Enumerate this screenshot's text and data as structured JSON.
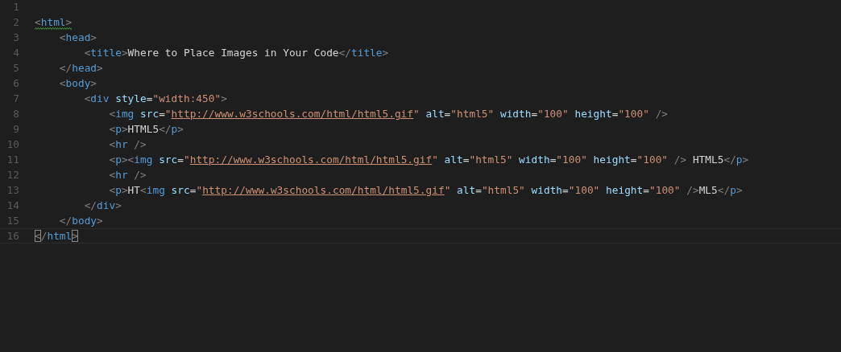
{
  "editor": {
    "lines": [
      {
        "number": "1",
        "current": false
      },
      {
        "number": "2",
        "current": false,
        "warning": true,
        "bracket_match": false,
        "tokens": [
          {
            "kind": "punct",
            "text": "<"
          },
          {
            "kind": "tag",
            "text": "html"
          },
          {
            "kind": "punct",
            "text": ">"
          }
        ]
      },
      {
        "number": "3",
        "current": false,
        "warning": false,
        "bracket_match": false,
        "tokens": [
          {
            "kind": "punct",
            "text": "    <"
          },
          {
            "kind": "tag",
            "text": "head"
          },
          {
            "kind": "punct",
            "text": ">"
          }
        ]
      },
      {
        "number": "4",
        "current": false,
        "warning": false,
        "bracket_match": false,
        "tokens": [
          {
            "kind": "punct",
            "text": "        <"
          },
          {
            "kind": "tag",
            "text": "title"
          },
          {
            "kind": "punct",
            "text": ">"
          },
          {
            "kind": "text",
            "text": "Where to Place Images in Your Code"
          },
          {
            "kind": "punct",
            "text": "</"
          },
          {
            "kind": "tag",
            "text": "title"
          },
          {
            "kind": "punct",
            "text": ">"
          }
        ]
      },
      {
        "number": "5",
        "current": false,
        "warning": false,
        "bracket_match": false,
        "tokens": [
          {
            "kind": "punct",
            "text": "    </"
          },
          {
            "kind": "tag",
            "text": "head"
          },
          {
            "kind": "punct",
            "text": ">"
          }
        ]
      },
      {
        "number": "6",
        "current": false,
        "warning": false,
        "bracket_match": false,
        "tokens": [
          {
            "kind": "punct",
            "text": "    <"
          },
          {
            "kind": "tag",
            "text": "body"
          },
          {
            "kind": "punct",
            "text": ">"
          }
        ]
      },
      {
        "number": "7",
        "current": false,
        "warning": false,
        "bracket_match": false,
        "tokens": [
          {
            "kind": "punct",
            "text": "        <"
          },
          {
            "kind": "tag",
            "text": "div"
          },
          {
            "kind": "attr",
            "text": " style"
          },
          {
            "kind": "eq",
            "text": "="
          },
          {
            "kind": "string",
            "text": "\"width:450\""
          },
          {
            "kind": "punct",
            "text": ">"
          }
        ]
      },
      {
        "number": "8",
        "current": false,
        "warning": false,
        "bracket_match": false,
        "tokens": [
          {
            "kind": "punct",
            "text": "            <"
          },
          {
            "kind": "tag",
            "text": "img"
          },
          {
            "kind": "attr",
            "text": " src"
          },
          {
            "kind": "eq",
            "text": "="
          },
          {
            "kind": "string",
            "text": "\""
          },
          {
            "kind": "url",
            "text": "http://www.w3schools.com/html/html5.gif"
          },
          {
            "kind": "string",
            "text": "\""
          },
          {
            "kind": "attr",
            "text": " alt"
          },
          {
            "kind": "eq",
            "text": "="
          },
          {
            "kind": "string",
            "text": "\"html5\""
          },
          {
            "kind": "attr",
            "text": " width"
          },
          {
            "kind": "eq",
            "text": "="
          },
          {
            "kind": "string",
            "text": "\"100\""
          },
          {
            "kind": "attr",
            "text": " height"
          },
          {
            "kind": "eq",
            "text": "="
          },
          {
            "kind": "string",
            "text": "\"100\""
          },
          {
            "kind": "punct",
            "text": " />"
          }
        ]
      },
      {
        "number": "9",
        "current": false,
        "warning": false,
        "bracket_match": false,
        "tokens": [
          {
            "kind": "punct",
            "text": "            <"
          },
          {
            "kind": "tag",
            "text": "p"
          },
          {
            "kind": "punct",
            "text": ">"
          },
          {
            "kind": "text",
            "text": "HTML5"
          },
          {
            "kind": "punct",
            "text": "</"
          },
          {
            "kind": "tag",
            "text": "p"
          },
          {
            "kind": "punct",
            "text": ">"
          }
        ]
      },
      {
        "number": "10",
        "current": false,
        "warning": false,
        "bracket_match": false,
        "tokens": [
          {
            "kind": "punct",
            "text": "            <"
          },
          {
            "kind": "tag",
            "text": "hr"
          },
          {
            "kind": "punct",
            "text": " />"
          }
        ]
      },
      {
        "number": "11",
        "current": false,
        "warning": false,
        "bracket_match": false,
        "tokens": [
          {
            "kind": "punct",
            "text": "            <"
          },
          {
            "kind": "tag",
            "text": "p"
          },
          {
            "kind": "punct",
            "text": "><"
          },
          {
            "kind": "tag",
            "text": "img"
          },
          {
            "kind": "attr",
            "text": " src"
          },
          {
            "kind": "eq",
            "text": "="
          },
          {
            "kind": "string",
            "text": "\""
          },
          {
            "kind": "url",
            "text": "http://www.w3schools.com/html/html5.gif"
          },
          {
            "kind": "string",
            "text": "\""
          },
          {
            "kind": "attr",
            "text": " alt"
          },
          {
            "kind": "eq",
            "text": "="
          },
          {
            "kind": "string",
            "text": "\"html5\""
          },
          {
            "kind": "attr",
            "text": " width"
          },
          {
            "kind": "eq",
            "text": "="
          },
          {
            "kind": "string",
            "text": "\"100\""
          },
          {
            "kind": "attr",
            "text": " height"
          },
          {
            "kind": "eq",
            "text": "="
          },
          {
            "kind": "string",
            "text": "\"100\""
          },
          {
            "kind": "punct",
            "text": " />"
          },
          {
            "kind": "text",
            "text": " HTML5"
          },
          {
            "kind": "punct",
            "text": "</"
          },
          {
            "kind": "tag",
            "text": "p"
          },
          {
            "kind": "punct",
            "text": ">"
          }
        ]
      },
      {
        "number": "12",
        "current": false,
        "warning": false,
        "bracket_match": false,
        "tokens": [
          {
            "kind": "punct",
            "text": "            <"
          },
          {
            "kind": "tag",
            "text": "hr"
          },
          {
            "kind": "punct",
            "text": " />"
          }
        ]
      },
      {
        "number": "13",
        "current": false,
        "warning": false,
        "bracket_match": false,
        "tokens": [
          {
            "kind": "punct",
            "text": "            <"
          },
          {
            "kind": "tag",
            "text": "p"
          },
          {
            "kind": "punct",
            "text": ">"
          },
          {
            "kind": "text",
            "text": "HT"
          },
          {
            "kind": "punct",
            "text": "<"
          },
          {
            "kind": "tag",
            "text": "img"
          },
          {
            "kind": "attr",
            "text": " src"
          },
          {
            "kind": "eq",
            "text": "="
          },
          {
            "kind": "string",
            "text": "\""
          },
          {
            "kind": "url",
            "text": "http://www.w3schools.com/html/html5.gif"
          },
          {
            "kind": "string",
            "text": "\""
          },
          {
            "kind": "attr",
            "text": " alt"
          },
          {
            "kind": "eq",
            "text": "="
          },
          {
            "kind": "string",
            "text": "\"html5\""
          },
          {
            "kind": "attr",
            "text": " width"
          },
          {
            "kind": "eq",
            "text": "="
          },
          {
            "kind": "string",
            "text": "\"100\""
          },
          {
            "kind": "attr",
            "text": " height"
          },
          {
            "kind": "eq",
            "text": "="
          },
          {
            "kind": "string",
            "text": "\"100\""
          },
          {
            "kind": "punct",
            "text": " />"
          },
          {
            "kind": "text",
            "text": "ML5"
          },
          {
            "kind": "punct",
            "text": "</"
          },
          {
            "kind": "tag",
            "text": "p"
          },
          {
            "kind": "punct",
            "text": ">"
          }
        ]
      },
      {
        "number": "14",
        "current": false,
        "warning": false,
        "bracket_match": false,
        "tokens": [
          {
            "kind": "punct",
            "text": "        </"
          },
          {
            "kind": "tag",
            "text": "div"
          },
          {
            "kind": "punct",
            "text": ">"
          }
        ]
      },
      {
        "number": "15",
        "current": false,
        "warning": false,
        "bracket_match": false,
        "tokens": [
          {
            "kind": "punct",
            "text": "    </"
          },
          {
            "kind": "tag",
            "text": "body"
          },
          {
            "kind": "punct",
            "text": ">"
          }
        ]
      },
      {
        "number": "16",
        "current": true,
        "warning": false,
        "bracket_match": true,
        "tokens": [
          {
            "kind": "punct",
            "text": "<"
          },
          {
            "kind": "punct",
            "text": "/"
          },
          {
            "kind": "tag",
            "text": "html"
          },
          {
            "kind": "punct",
            "text": ">"
          }
        ]
      }
    ]
  }
}
